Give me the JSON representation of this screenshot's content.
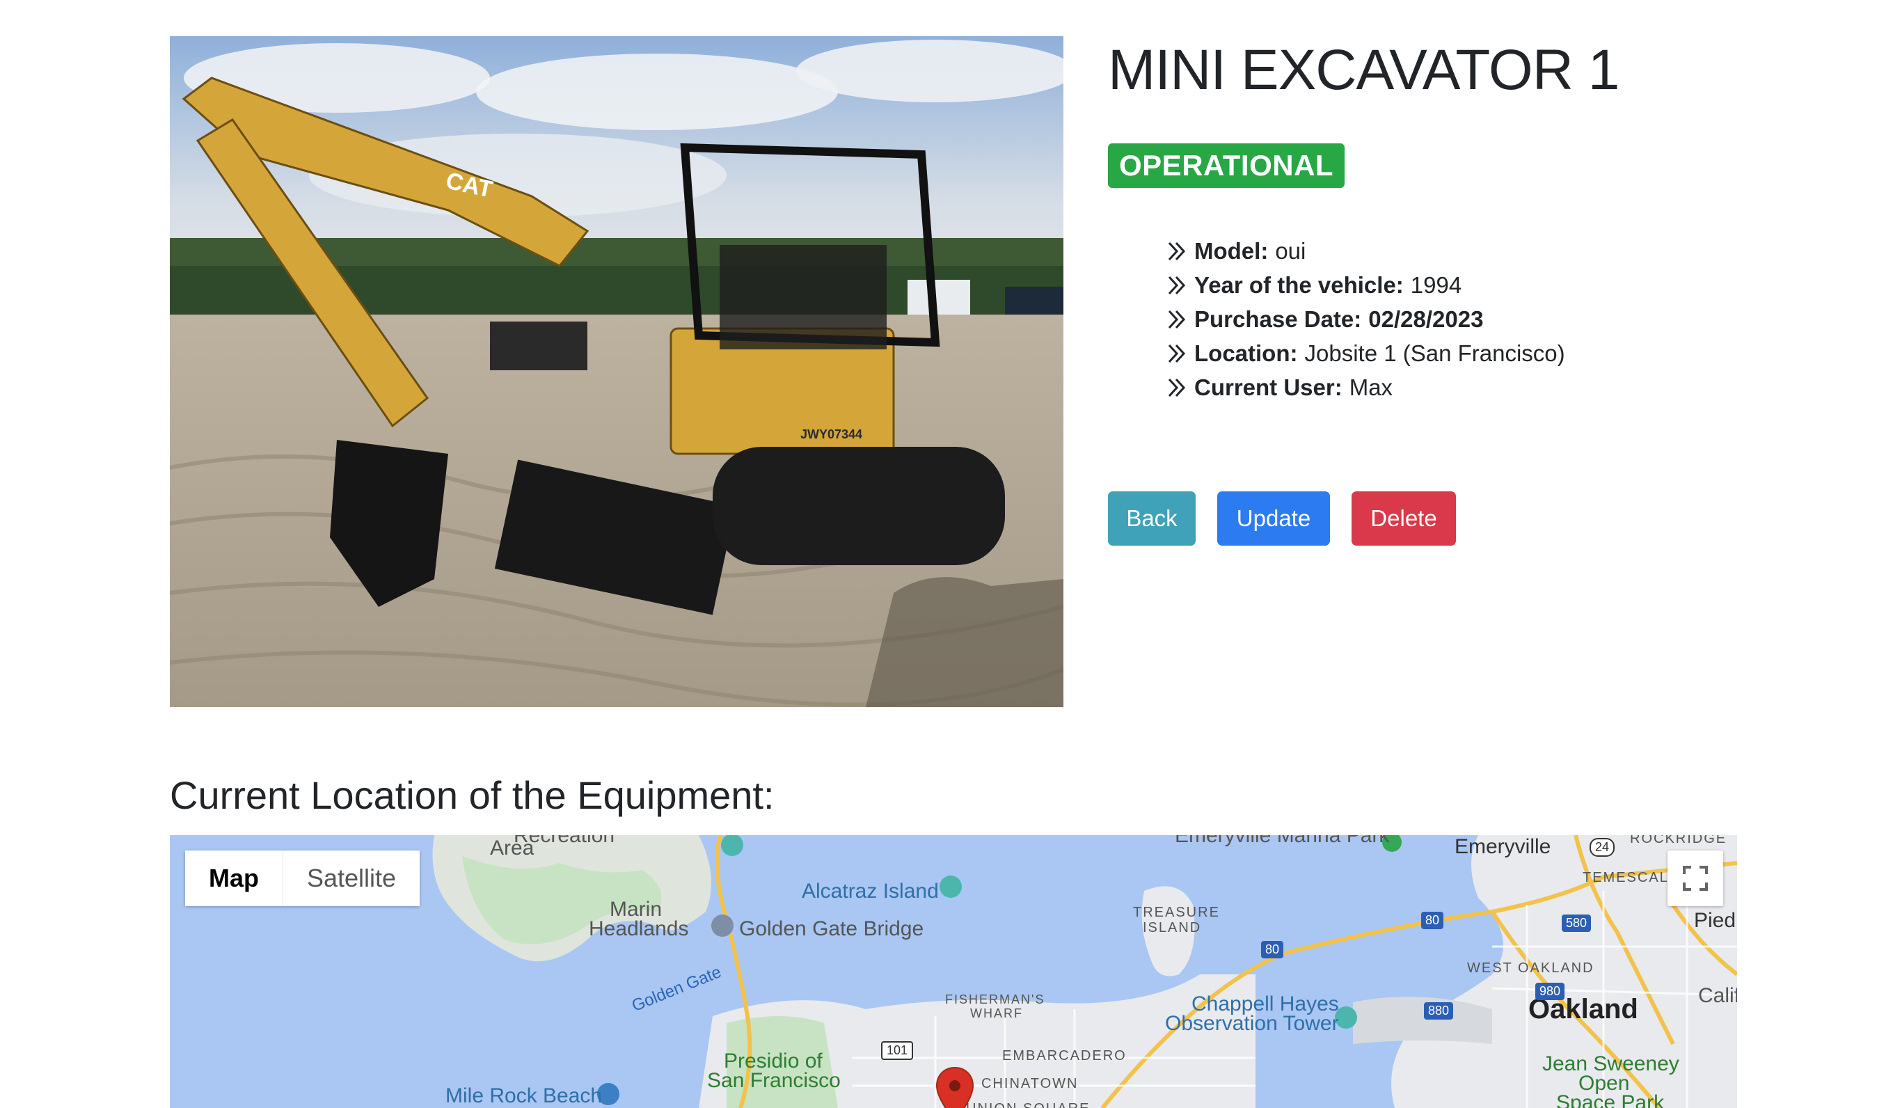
{
  "equipment": {
    "title": "MINI EXCAVATOR 1",
    "status": "OPERATIONAL",
    "photo_alt": "Mini excavator photo",
    "specs": [
      {
        "key": "Model:",
        "value": "oui"
      },
      {
        "key": "Year of the vehicle:",
        "value": "1994"
      },
      {
        "key": "Purchase Date:",
        "value": "02/28/2023"
      },
      {
        "key": "Location:",
        "value": "Jobsite 1 (San Francisco)"
      },
      {
        "key": "Current User:",
        "value": "Max"
      }
    ]
  },
  "photo_markings": {
    "brand": "CAT",
    "serial": "JWY07344"
  },
  "actions": {
    "back": "Back",
    "update": "Update",
    "delete": "Delete"
  },
  "colors": {
    "status_green": "#28a745",
    "back": "#3fa2b8",
    "update": "#2d7bf0",
    "delete": "#d9394a",
    "water": "#a9c7f2",
    "map_pin": "#d93025"
  },
  "map_section": {
    "heading": "Current Location of the Equipment:",
    "map_type": {
      "map": "Map",
      "satellite": "Satellite",
      "selected": "Map"
    },
    "fullscreen_icon": "fullscreen-icon",
    "labels": {
      "recreation_area": "Area",
      "recreation_area_top": "Recreation",
      "marin_headlands_1": "Marin",
      "marin_headlands_2": "Headlands",
      "golden_gate_bridge": "Golden Gate Bridge",
      "golden_gate": "Golden Gate",
      "alcatraz": "Alcatraz Island",
      "treasure_island_1": "TREASURE",
      "treasure_island_2": "ISLAND",
      "emeryville_marina": "Emeryville Marina Park",
      "emeryville": "Emeryville",
      "rockridge": "ROCKRIDGE",
      "temescal": "TEMESCAL",
      "piedmont": "Piedi",
      "west_oakland": "WEST OAKLAND",
      "oakland": "Oakland",
      "california": "Calif",
      "chappell_1": "Chappell Hayes",
      "chappell_2": "Observation Tower",
      "fishermans_1": "FISHERMAN'S",
      "fishermans_2": "WHARF",
      "embarcadero": "EMBARCADERO",
      "chinatown": "CHINATOWN",
      "union_square": "UNION SQUARE",
      "presidio_1": "Presidio of",
      "presidio_2": "San Francisco",
      "mile_rock": "Mile Rock Beach",
      "jean_1": "Jean Sweeney",
      "jean_2": "Open",
      "jean_3": "Space Park"
    },
    "shields": {
      "i80_a": "80",
      "i80_b": "80",
      "i80_c": "80",
      "i580": "580",
      "i880": "880",
      "i980": "980",
      "us101": "101",
      "r24": "24"
    }
  }
}
